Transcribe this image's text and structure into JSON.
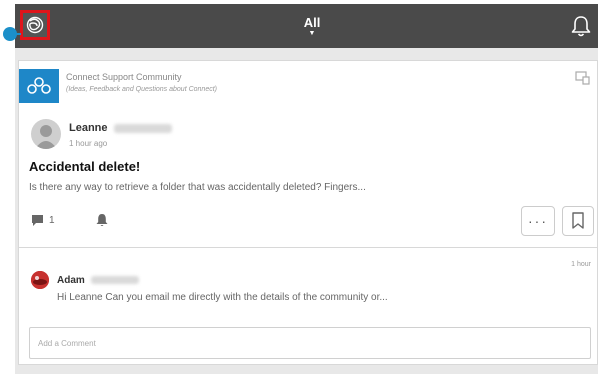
{
  "header": {
    "filter_label": "All",
    "filter_caret": "▼"
  },
  "post": {
    "community_name": "Connect Support Community",
    "community_description": "(Ideas, Feedback and Questions about Connect)",
    "author_first_name": "Leanne",
    "time": "1 hour ago",
    "title": "Accidental delete!",
    "snippet": "Is there any way to retrieve a folder that was accidentally deleted? Fingers...",
    "comment_count": "1",
    "more_label": "···"
  },
  "reply": {
    "author_first_name": "Adam",
    "time": "1 hour",
    "text": "Hi Leanne Can you email me directly with the details of the community or..."
  },
  "comment_input": {
    "placeholder": "Add a Comment"
  },
  "colors": {
    "topbar": "#4a4a4a",
    "highlight": "#e0151b",
    "pointer": "#1b8fc9",
    "community_logo": "#1e87c8"
  },
  "icons": [
    "app-logo-icon",
    "bell-icon",
    "share-icon",
    "comment-icon",
    "follow-bell-icon",
    "bookmark-icon"
  ]
}
